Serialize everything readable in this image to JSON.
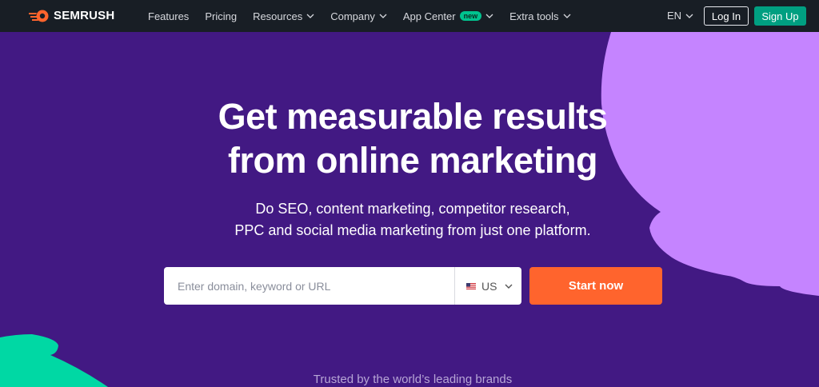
{
  "brand": {
    "name": "SEMRUSH"
  },
  "nav": {
    "items": [
      {
        "label": "Features",
        "has_dropdown": false
      },
      {
        "label": "Pricing",
        "has_dropdown": false
      },
      {
        "label": "Resources",
        "has_dropdown": true
      },
      {
        "label": "Company",
        "has_dropdown": true
      },
      {
        "label": "App Center",
        "has_dropdown": true,
        "badge": "new"
      },
      {
        "label": "Extra tools",
        "has_dropdown": true
      }
    ],
    "language": "EN",
    "login_label": "Log In",
    "signup_label": "Sign Up"
  },
  "hero": {
    "title_line1": "Get measurable results",
    "title_line2": "from online marketing",
    "subtitle_line1": "Do SEO, content marketing, competitor research,",
    "subtitle_line2": "PPC and social media marketing from just one platform."
  },
  "search": {
    "placeholder": "Enter domain, keyword or URL",
    "value": "",
    "database": "US",
    "database_icon": "us-flag-icon",
    "submit_label": "Start now"
  },
  "trusted_text": "Trusted by the world’s leading brands",
  "colors": {
    "nav_bg": "#181e25",
    "hero_bg": "#421983",
    "accent_orange": "#ff642d",
    "signup_green": "#009f81",
    "badge_green": "#00c38e",
    "blob_purple": "#c584ff",
    "blob_teal": "#00d8a4"
  }
}
